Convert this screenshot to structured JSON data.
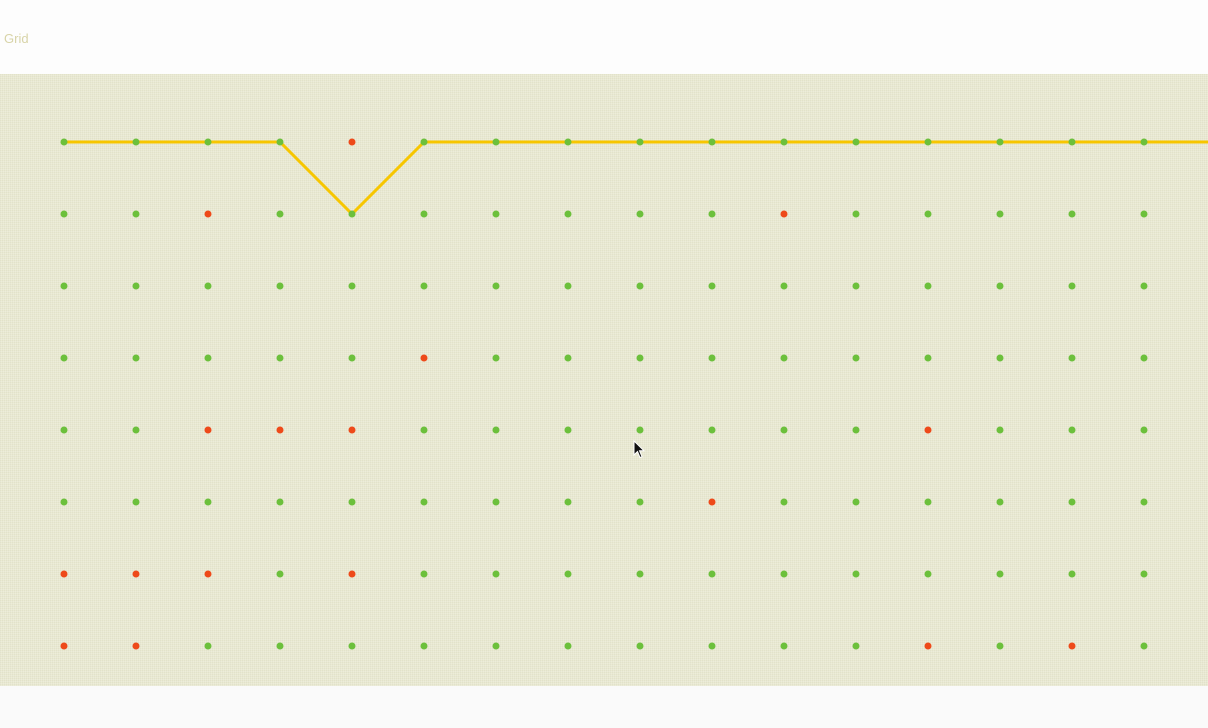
{
  "title": "Grid",
  "colors": {
    "background": "#e9e9d1",
    "node_default": "#6cc03c",
    "node_blocked": "#ee4a1a",
    "path": "#f7c600"
  },
  "grid": {
    "columns": 16,
    "rows": 8,
    "blocked": [
      [
        0,
        4
      ],
      [
        1,
        2
      ],
      [
        1,
        10
      ],
      [
        3,
        5
      ],
      [
        4,
        2
      ],
      [
        4,
        3
      ],
      [
        4,
        4
      ],
      [
        4,
        12
      ],
      [
        5,
        9
      ],
      [
        6,
        0
      ],
      [
        6,
        1
      ],
      [
        6,
        2
      ],
      [
        6,
        4
      ],
      [
        7,
        0
      ],
      [
        7,
        1
      ],
      [
        7,
        12
      ],
      [
        7,
        14
      ]
    ],
    "path": [
      [
        0,
        0
      ],
      [
        0,
        1
      ],
      [
        0,
        2
      ],
      [
        0,
        3
      ],
      [
        1,
        4
      ],
      [
        0,
        5
      ],
      [
        0,
        6
      ],
      [
        0,
        7
      ],
      [
        0,
        8
      ],
      [
        0,
        9
      ],
      [
        0,
        10
      ],
      [
        0,
        11
      ],
      [
        0,
        12
      ],
      [
        0,
        13
      ],
      [
        0,
        14
      ],
      [
        0,
        15
      ],
      [
        0,
        16
      ]
    ]
  },
  "cursor_icon": "arrow-pointer-icon"
}
